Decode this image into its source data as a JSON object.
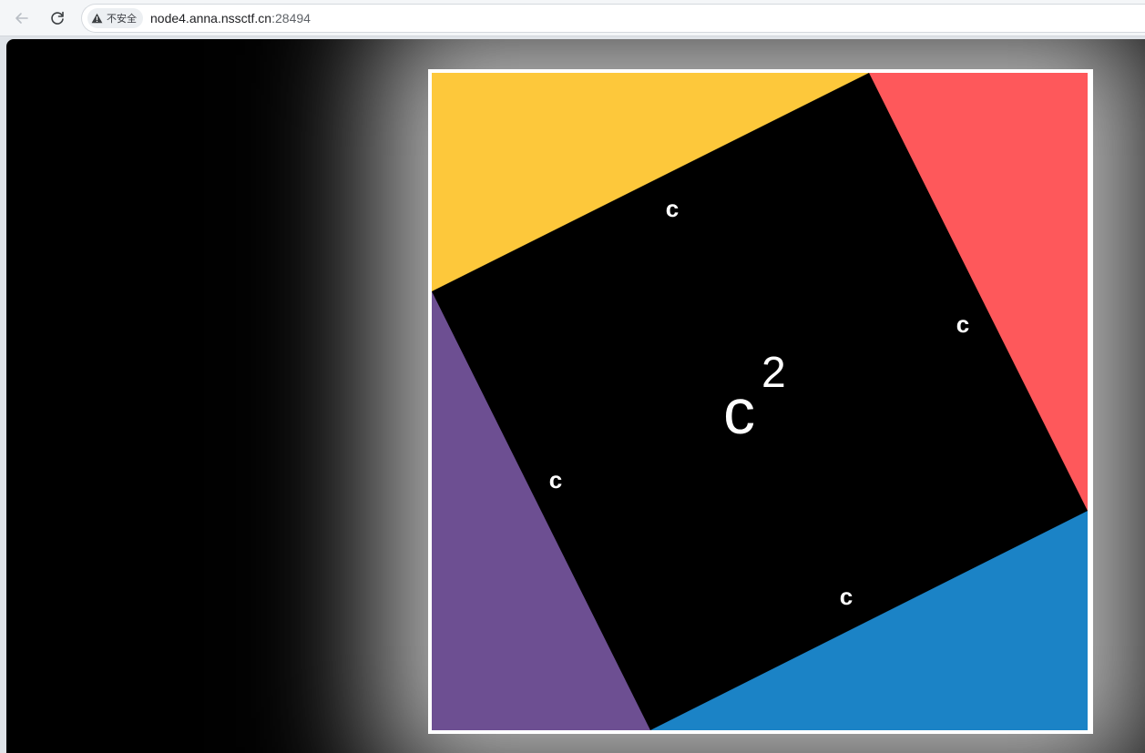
{
  "browser": {
    "back_icon": "arrow-left-icon",
    "reload_icon": "reload-icon",
    "security_icon": "warning-triangle-icon",
    "security_label": "不安全",
    "url_host": "node4.anna.nssctf.cn",
    "url_port": ":28494"
  },
  "figure": {
    "labels": {
      "top": "c",
      "right": "c",
      "left": "c",
      "bottom": "c"
    },
    "center_base": "c",
    "center_exponent": "2",
    "colors": {
      "yellow_triangle": "#fdc83b",
      "red_triangle": "#fe585b",
      "purple_triangle": "#6d4f92",
      "blue_triangle": "#1b83c6",
      "center_square": "#000000",
      "frame": "#ffffff"
    }
  }
}
